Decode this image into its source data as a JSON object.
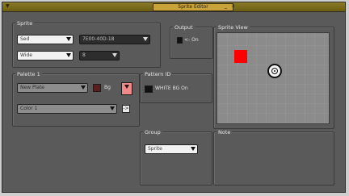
{
  "window": {
    "title": "Sprite Editor",
    "controls": {
      "minimize": "_",
      "close": "x"
    }
  },
  "sprite_group": {
    "label": "Sprite",
    "type_select": {
      "value": "Sed"
    },
    "id_select": {
      "value": "7E00-40D-18"
    },
    "mode_select": {
      "value": "Wide"
    },
    "size_select": {
      "value": "8"
    }
  },
  "palette_group": {
    "label": "Palette 1",
    "palette_select": {
      "value": "New Plate"
    },
    "color_swatch_label": "Bg",
    "secondary_select": {
      "value": "Color 1"
    },
    "apply_button": "->"
  },
  "colors": {
    "swatch_dark": "#5a1e1e",
    "swatch_pink": "#f08a8a",
    "sprite_red": "#ff0000",
    "window_bg": "#5a5a5a"
  },
  "output_group": {
    "label": "Output",
    "value": "<- On"
  },
  "preview_group": {
    "label": "Sprite View"
  },
  "pattern_group": {
    "label": "Pattern ID",
    "value": "WHITE  BG  On"
  },
  "group_group": {
    "label": "Group",
    "select": {
      "value": "Sprite"
    }
  },
  "note_group": {
    "label": "Note"
  }
}
